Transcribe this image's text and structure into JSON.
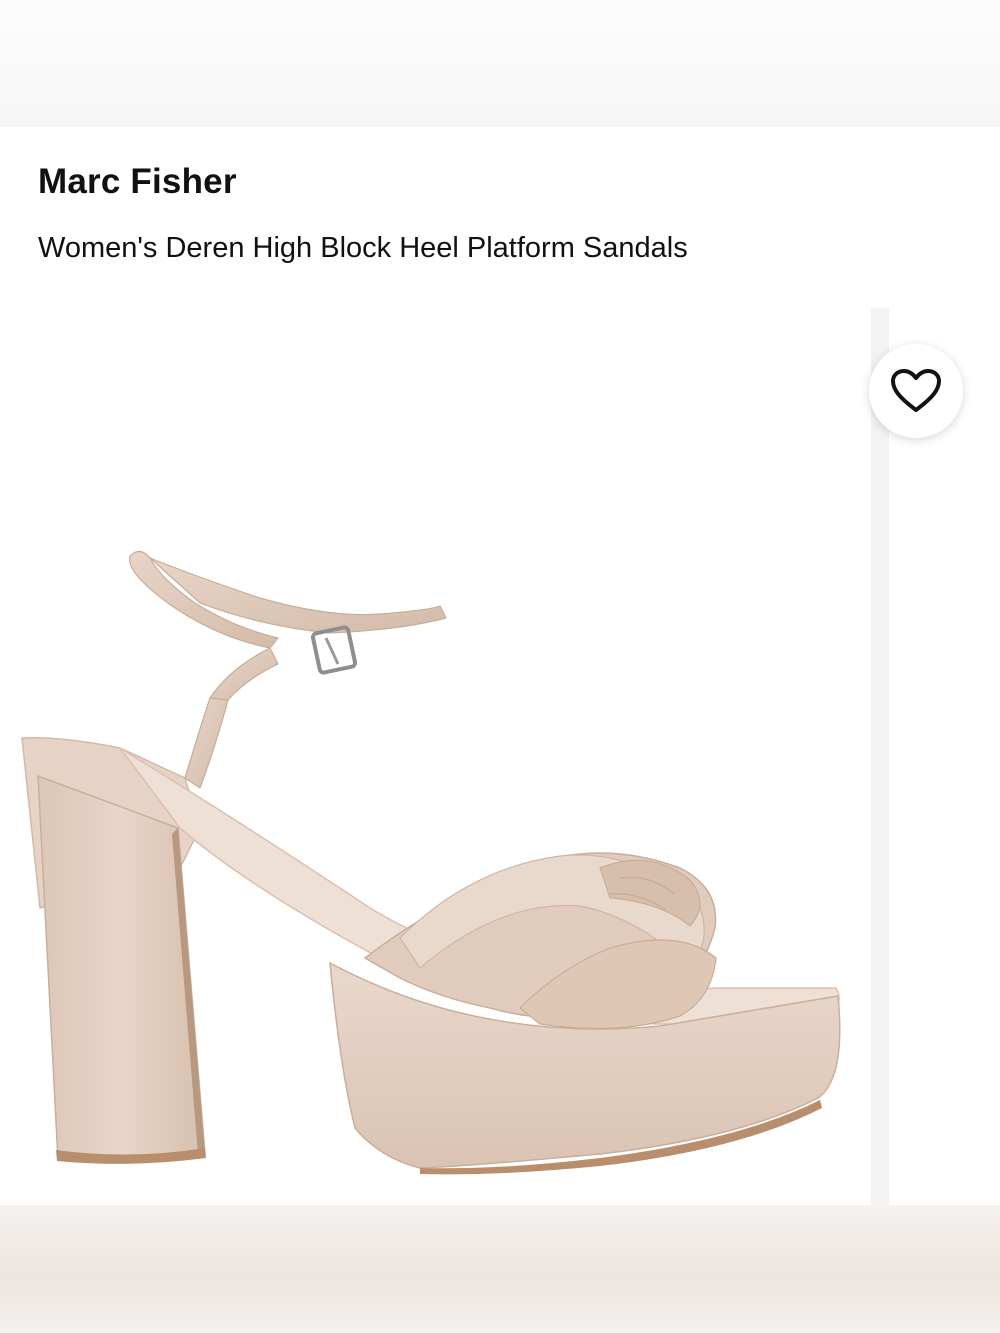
{
  "product": {
    "brand": "Marc Fisher",
    "title": "Women's Deren High Block Heel Platform Sandals"
  },
  "favorite": {
    "icon": "heart-outline-icon"
  },
  "colors": {
    "sandal": "#e3cfc2",
    "sandal_shadow": "#cdb6a6",
    "sole_edge": "#b98e6c",
    "buckle": "#9a9a9a"
  }
}
